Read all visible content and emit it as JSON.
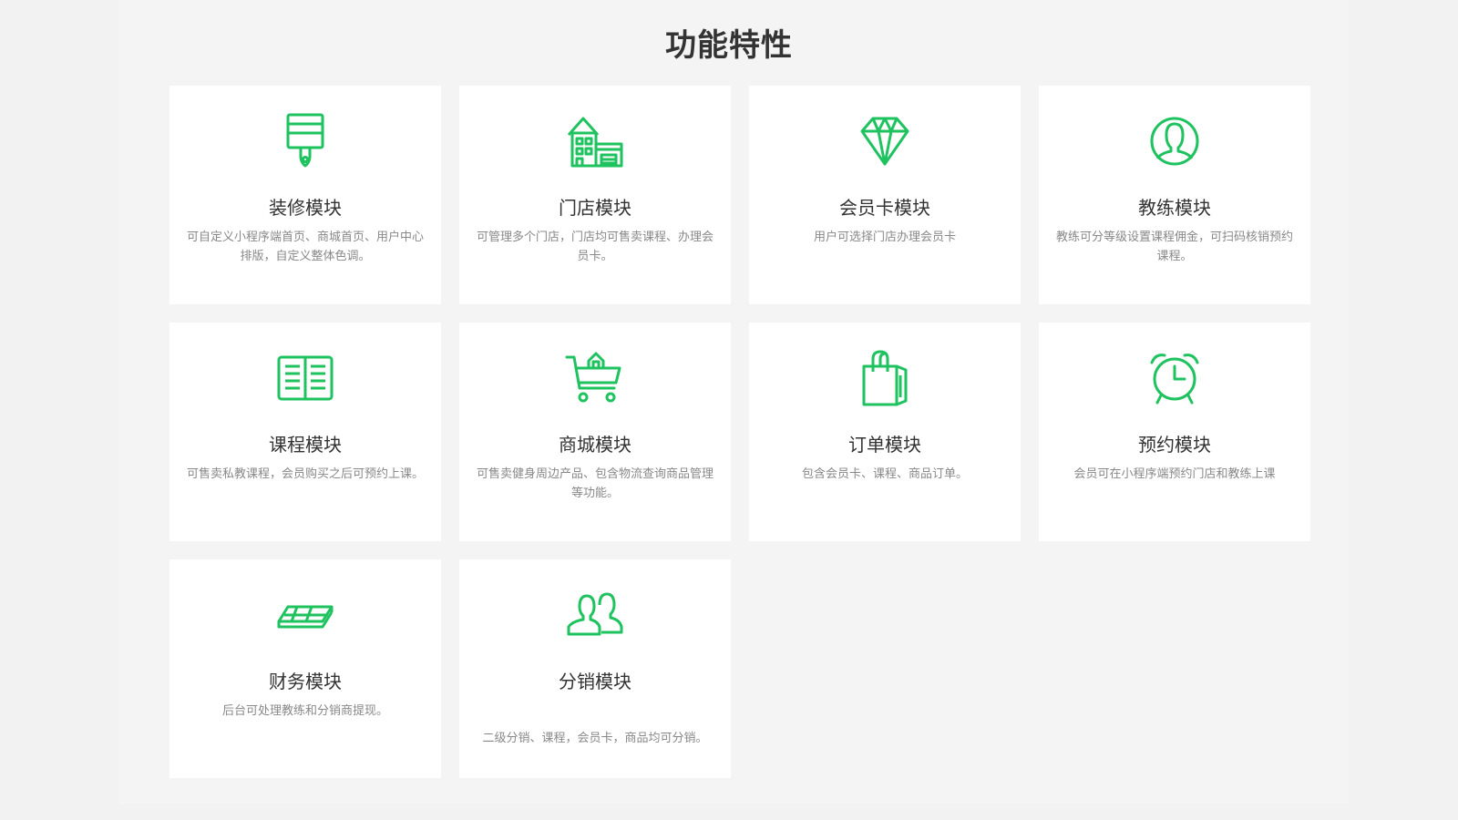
{
  "page": {
    "title": "功能特性",
    "accent_color": "#1ec25f"
  },
  "features": [
    {
      "icon": "paint-brush-icon",
      "title": "装修模块",
      "desc": "可自定义小程序端首页、商城首页、用户中心排版，自定义整体色调。"
    },
    {
      "icon": "store-building-icon",
      "title": "门店模块",
      "desc": "可管理多个门店，门店均可售卖课程、办理会员卡。"
    },
    {
      "icon": "diamond-icon",
      "title": "会员卡模块",
      "desc": "用户可选择门店办理会员卡"
    },
    {
      "icon": "user-avatar-icon",
      "title": "教练模块",
      "desc": "教练可分等级设置课程佣金，可扫码核销预约课程。"
    },
    {
      "icon": "open-book-icon",
      "title": "课程模块",
      "desc": "可售卖私教课程，会员购买之后可预约上课。"
    },
    {
      "icon": "shopping-cart-icon",
      "title": "商城模块",
      "desc": "可售卖健身周边产品、包含物流查询商品管理等功能。"
    },
    {
      "icon": "shopping-bag-icon",
      "title": "订单模块",
      "desc": "包含会员卡、课程、商品订单。"
    },
    {
      "icon": "alarm-clock-icon",
      "title": "预约模块",
      "desc": "会员可在小程序端预约门店和教练上课"
    },
    {
      "icon": "money-stack-icon",
      "title": "财务模块",
      "desc": "后台可处理教练和分销商提现。"
    },
    {
      "icon": "users-group-icon",
      "title": "分销模块",
      "desc": "二级分销、课程，会员卡，商品均可分销。"
    }
  ]
}
